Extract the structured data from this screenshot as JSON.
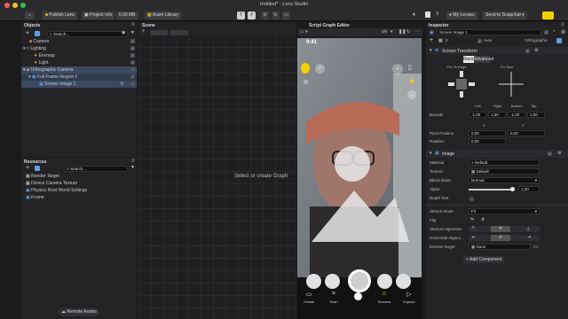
{
  "window": {
    "title": "Untitled* - Lens Studio"
  },
  "toolbar": {
    "publish": "Publish Lens",
    "project_info": "Project Info",
    "size": "0.00 MB",
    "asset_library": "Asset Library",
    "my_lenses": "My Lenses",
    "send": "Send to Snapchat"
  },
  "objects": {
    "title": "Objects",
    "search_placeholder": "Search...",
    "items": [
      {
        "label": "Camera"
      },
      {
        "label": "Lighting"
      },
      {
        "label": "Envmap"
      },
      {
        "label": "Light"
      },
      {
        "label": "Orthographic Camera"
      },
      {
        "label": "Full Frame Region 1"
      },
      {
        "label": "Screen Image 1",
        "value": "0"
      }
    ]
  },
  "resources": {
    "title": "Resources",
    "search_placeholder": "Search...",
    "items": [
      {
        "label": "Render Target"
      },
      {
        "label": "Device Camera Texture"
      },
      {
        "label": "Physics Root World Settings"
      },
      {
        "label": "Frame"
      }
    ],
    "remote_assets": "Remote Assets"
  },
  "scene": {
    "title": "Scene",
    "placeholder": "Select or create Graph"
  },
  "script_graph": {
    "title": "Script Graph Editor"
  },
  "preview": {
    "resolution": "0/0",
    "time": "9:41",
    "nav": [
      "Create",
      "Scan",
      "",
      "Screens",
      "Explore"
    ]
  },
  "inspector": {
    "title": "Inspector",
    "object_name": "Screen Image 1",
    "layer": "0",
    "auto": "Auto",
    "camera": "Orthographic",
    "screen_transform": {
      "title": "Screen Transform",
      "tab_basic": "Basic",
      "tab_advanced": "Advanced",
      "pin_to_edge": "Pin To Edge",
      "fix_size": "Fix Size",
      "col_left": "Left",
      "col_right": "Right",
      "col_bottom": "Bottom",
      "col_top": "Top",
      "bounds_label": "Bounds",
      "bounds": [
        "-1,00",
        "1,00",
        "-1,00",
        "1,00"
      ],
      "col_x": "X",
      "col_y": "Y",
      "pivot_label": "Pivot Position",
      "pivot": [
        "0,00",
        "0,00"
      ],
      "rotation_label": "Rotation",
      "rotation": "0,00"
    },
    "image": {
      "title": "Image",
      "material_label": "Material",
      "material": "Default",
      "texture_label": "Texture",
      "texture": "Default",
      "blend_label": "Blend Mode",
      "blend": "Normal",
      "alpha_label": "Alpha",
      "alpha": "1,00",
      "alpha_level": 1.0,
      "depth_label": "Depth Test",
      "stretch_label": "Stretch Mode",
      "stretch": "Fit",
      "flip_label": "Flip",
      "valign_label": "Vertical Alignment",
      "halign_label": "Horizontal Alignm...",
      "extents_label": "Extents Target",
      "extents": "None"
    },
    "add_component": "+ Add Component"
  },
  "colors": {
    "accent": "#2d6cdf",
    "yellow": "#f5d000",
    "selection": "#3b4a63"
  }
}
